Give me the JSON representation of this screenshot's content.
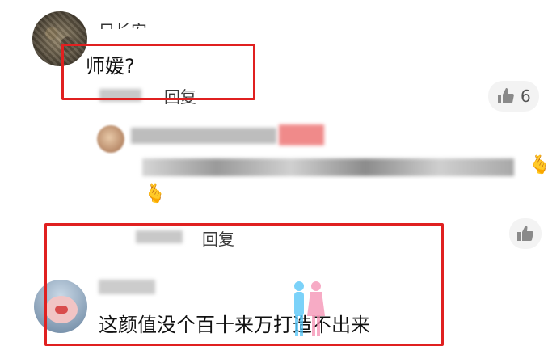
{
  "comment_1": {
    "username_partial": "只长安",
    "text": "师媛?",
    "reply_label": "回复",
    "like_count": "6"
  },
  "reply_thread": {
    "emoji": "🫰"
  },
  "comment_2": {
    "reply_label": "回复",
    "text": "这颜值没个百十来万打造不出来"
  },
  "icons": {
    "like": "thumbs-up-icon",
    "heart_hand": "finger-heart-icon"
  },
  "colors": {
    "highlight": "#e02020",
    "pill_bg": "#f3f3f3"
  }
}
